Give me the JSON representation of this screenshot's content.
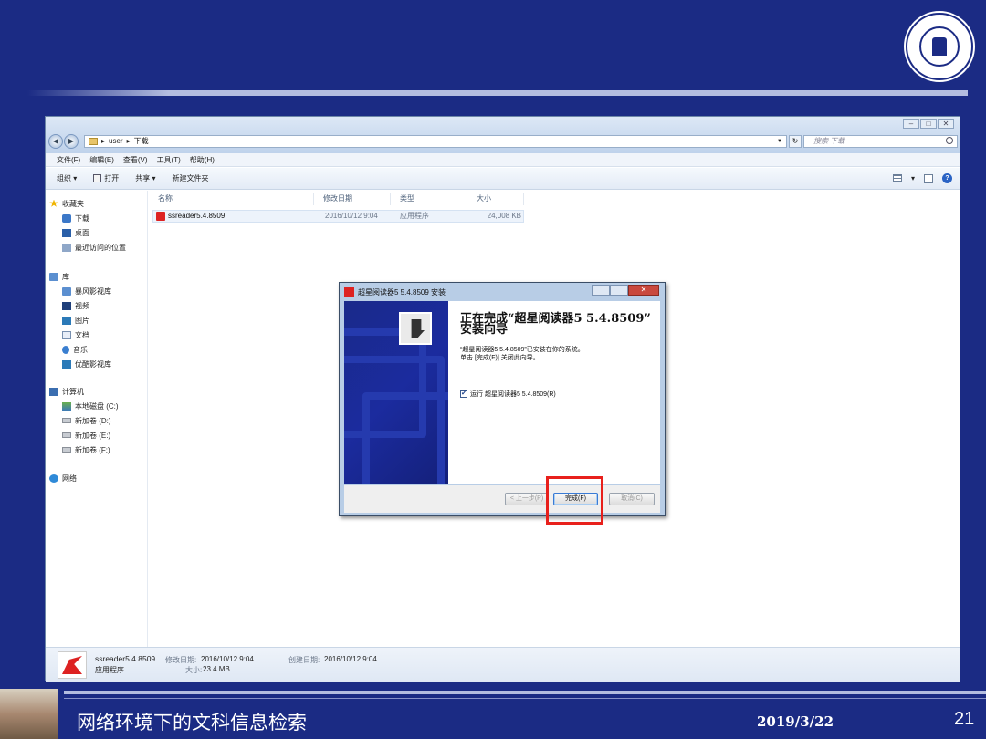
{
  "explorer": {
    "breadcrumb": [
      "user",
      "下载"
    ],
    "search_placeholder": "搜索 下载",
    "menu": [
      "文件(F)",
      "编辑(E)",
      "查看(V)",
      "工具(T)",
      "帮助(H)"
    ],
    "toolbar": {
      "organize": "组织 ▾",
      "open": "打开",
      "share": "共享 ▾",
      "new_folder": "新建文件夹"
    },
    "nav": {
      "favorites": "收藏夹",
      "downloads": "下载",
      "desktop": "桌面",
      "recent": "最近访问的位置",
      "libraries": "库",
      "storm_lib": "暴风影视库",
      "videos": "视频",
      "pictures": "图片",
      "documents": "文档",
      "music": "音乐",
      "youku_lib": "优酷影视库",
      "computer": "计算机",
      "drive_c": "本地磁盘 (C:)",
      "drive_d": "新加卷 (D:)",
      "drive_e": "新加卷 (E:)",
      "drive_f": "新加卷 (F:)",
      "network": "网络"
    },
    "columns": [
      "名称",
      "修改日期",
      "类型",
      "大小"
    ],
    "file": {
      "name": "ssreader5.4.8509",
      "modified": "2016/10/12 9:04",
      "type": "应用程序",
      "size": "24,008 KB"
    },
    "details": {
      "name": "ssreader5.4.8509",
      "type": "应用程序",
      "modified_label": "修改日期:",
      "modified": "2016/10/12 9:04",
      "size_label": "大小:",
      "size": "23.4 MB",
      "created_label": "创建日期:",
      "created": "2016/10/12 9:04"
    }
  },
  "installer": {
    "title": "超星阅读器5 5.4.8509 安装",
    "heading_line1": "正在完成“超星阅读器5 5.4.8509”",
    "heading_line2": "安装向导",
    "body_line1": "“超星阅读器5 5.4.8509”已安装在你的系统。",
    "body_line2": "单击 [完成(F)] 关闭此向导。",
    "checkbox_label": "运行 超星阅读器5 5.4.8509(R)",
    "checkbox_checked": true,
    "back_button": "< 上一步(P)",
    "finish_button": "完成(F)",
    "cancel_button": "取消(C)"
  },
  "slide": {
    "footer_title": "网络环境下的文科信息检索",
    "date": "2019/3/22",
    "page_number": "21"
  },
  "colors": {
    "slide_background": "#1b2b84",
    "highlight_box": "#e8201c"
  }
}
